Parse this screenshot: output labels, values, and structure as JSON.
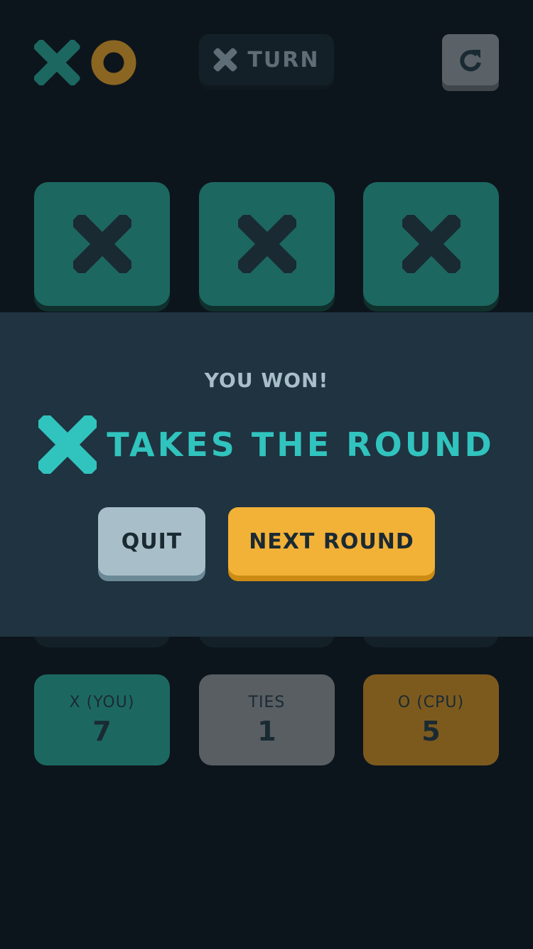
{
  "header": {
    "turn_label": "TURN",
    "turn_mark": "x-icon"
  },
  "board": {
    "visible_cells": [
      "X",
      "X",
      "X"
    ]
  },
  "result_modal": {
    "subtitle": "YOU WON!",
    "winner_mark": "x-icon",
    "headline": "TAKES THE ROUND",
    "quit_label": "QUIT",
    "next_label": "NEXT ROUND"
  },
  "scores": [
    {
      "label": "X (YOU)",
      "value": "7"
    },
    {
      "label": "TIES",
      "value": "1"
    },
    {
      "label": "O (CPU)",
      "value": "5"
    }
  ],
  "colors": {
    "background": "#0d151c",
    "x_accent": "#31c3bd",
    "o_accent": "#f2b137",
    "silver": "#a8bfc9",
    "cell": "#1c6861",
    "overlay": "#1f3340"
  }
}
